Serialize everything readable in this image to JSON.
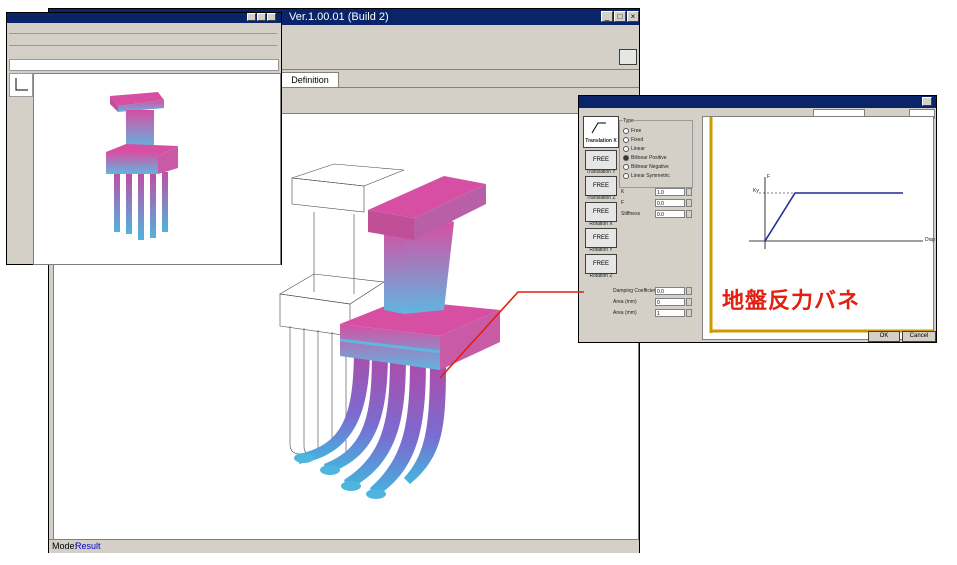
{
  "main_window": {
    "title": "Ver.1.00.01 (Build 2)",
    "tab_definition": "Definition",
    "status_label": "Mode:",
    "status_value": "Result"
  },
  "spring_dialog": {
    "dof_buttons": [
      {
        "label": "FREE",
        "caption": "Translation Y"
      },
      {
        "label": "FREE",
        "caption": "Translation Z"
      },
      {
        "label": "FREE",
        "caption": "Rotation X"
      },
      {
        "label": "FREE",
        "caption": "Rotation Y"
      },
      {
        "label": "FREE",
        "caption": "Rotation Z"
      }
    ],
    "active_dof_caption": "Translation X",
    "type_label": "Type",
    "type_options": [
      "Free",
      "Fixed",
      "Linear",
      "Bilinear Positive",
      "Bilinear Negative",
      "Linear Symmetric"
    ],
    "fields": [
      {
        "label": "K",
        "value": "1.0"
      },
      {
        "label": "F",
        "value": "0.0"
      },
      {
        "label": "Stiffness",
        "value": "0.0"
      }
    ],
    "lower_fields": [
      {
        "label": "Damping Coefficient",
        "value": "0.0"
      },
      {
        "label": "Area (mm)",
        "value": "0"
      },
      {
        "label": "Area (mm)",
        "value": "1"
      }
    ],
    "graph": {
      "y_label": "F",
      "x_label": "Disp",
      "k_label": "Ky"
    },
    "ok_label": "OK",
    "cancel_label": "Cancel",
    "callout": "地盤反力バネ"
  },
  "colors": {
    "titlebar": "#0a246a",
    "callout": "#e12010",
    "pier_top": "#d64fa3",
    "pier_mid": "#5fb6e0",
    "status_value": "#0000cc"
  }
}
